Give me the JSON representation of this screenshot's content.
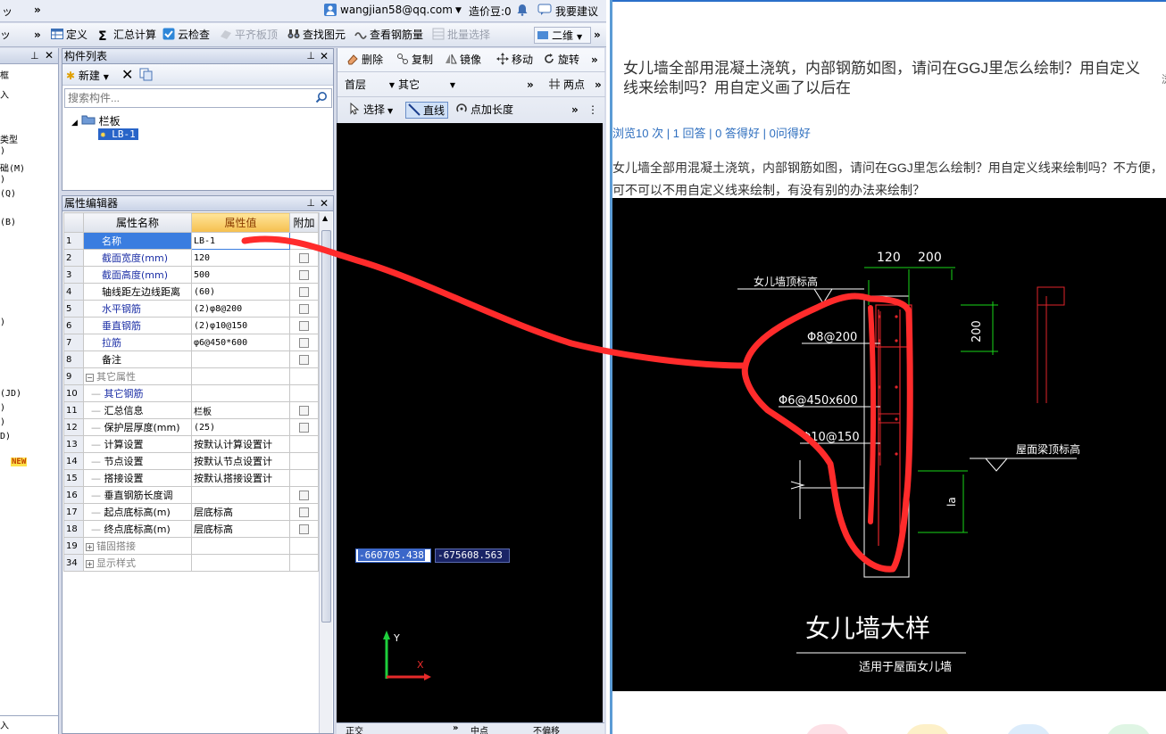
{
  "titlebar": {
    "left_glyph": "ッ",
    "user_email": "wangjian58@qq.com",
    "price_beans": "造价豆:0",
    "feedback": "我要建议"
  },
  "toolbar": {
    "define": "定义",
    "summary": "汇总计算",
    "cloud_check": "云检查",
    "flush_slab": "平齐板顶",
    "find_element": "查找图元",
    "view_rebar": "查看钢筋量",
    "batch_select": "批量选择",
    "view_mode": "二维"
  },
  "leftnav": {
    "rows": [
      "框",
      "入",
      "类型",
      ")",
      "础(M)",
      ")",
      "(Q)",
      "(B)",
      ")",
      "(JD)",
      ")",
      ")",
      "D)",
      "NEW",
      "入"
    ]
  },
  "complist": {
    "title": "构件列表",
    "new_label": "新建",
    "search_placeholder": "搜索构件...",
    "tree_root": "栏板",
    "tree_child": "LB-1"
  },
  "propedit": {
    "title": "属性编辑器",
    "col_name": "属性名称",
    "col_value": "属性值",
    "col_extra": "附加",
    "rows": [
      {
        "num": "1",
        "name": "名称",
        "value": "LB-1"
      },
      {
        "num": "2",
        "name": "截面宽度(mm)",
        "value": "120"
      },
      {
        "num": "3",
        "name": "截面高度(mm)",
        "value": "500"
      },
      {
        "num": "4",
        "name": "轴线距左边线距离",
        "value": "(60)"
      },
      {
        "num": "5",
        "name": "水平钢筋",
        "value": "(2)φ8@200"
      },
      {
        "num": "6",
        "name": "垂直钢筋",
        "value": "(2)φ10@150"
      },
      {
        "num": "7",
        "name": "拉筋",
        "value": "φ6@450*600"
      },
      {
        "num": "8",
        "name": "备注",
        "value": ""
      },
      {
        "num": "9",
        "name": "其它属性",
        "value": ""
      },
      {
        "num": "10",
        "name": "其它钢筋",
        "value": ""
      },
      {
        "num": "11",
        "name": "汇总信息",
        "value": "栏板"
      },
      {
        "num": "12",
        "name": "保护层厚度(mm)",
        "value": "(25)"
      },
      {
        "num": "13",
        "name": "计算设置",
        "value": "按默认计算设置计"
      },
      {
        "num": "14",
        "name": "节点设置",
        "value": "按默认节点设置计"
      },
      {
        "num": "15",
        "name": "搭接设置",
        "value": "按默认搭接设置计"
      },
      {
        "num": "16",
        "name": "垂直钢筋长度调",
        "value": ""
      },
      {
        "num": "17",
        "name": "起点底标高(m)",
        "value": "层底标高"
      },
      {
        "num": "18",
        "name": "终点底标高(m)",
        "value": "层底标高"
      },
      {
        "num": "19",
        "name": "锚固搭接",
        "value": ""
      },
      {
        "num": "34",
        "name": "显示样式",
        "value": ""
      }
    ]
  },
  "drawing": {
    "delete": "删除",
    "copy": "复制",
    "mirror": "镜像",
    "move": "移动",
    "rotate": "旋转",
    "floor": "首层",
    "category": "其它",
    "two_point": "两点",
    "select": "选择",
    "line": "直线",
    "point_length": "点加长度",
    "coord_x": "-660705.438",
    "coord_y": "-675608.563",
    "axis_y": "Y",
    "axis_x": "X",
    "bottom_tabs": [
      "正交",
      "中点",
      "不偏移"
    ]
  },
  "question": {
    "title": "女儿墙全部用混凝土浇筑，内部钢筋如图，请问在GGJ里怎么绘制？用自定义线来绘制吗？用自定义画了以后在",
    "stats_views": "浏览10 次",
    "stats_answers": "1 回答",
    "stats_good": "0 答得好",
    "stats_asks": "0问得好",
    "body": "女儿墙全部用混凝土浇筑，内部钢筋如图，请问在GGJ里怎么绘制？用自定义线来绘制吗？不方便，可不可以不用自定义线来绘制，有没有别的办法来绘制？",
    "edge_char": "浏"
  },
  "cad": {
    "dim_120": "120",
    "dim_200_top": "200",
    "dim_200_side": "200",
    "label_parapet_top": "女儿墙顶标高",
    "label_h_rebar": "Φ8@200",
    "label_tie": "Φ6@450x600",
    "label_v_rebar": "Φ10@150",
    "label_roof_beam": "屋面梁顶标高",
    "label_la": "la",
    "title": "女儿墙大样",
    "subtitle": "适用于屋面女儿墙"
  },
  "colors": {
    "annotation_red": "#ff2b2b",
    "cad_green": "#19d619",
    "cad_red": "#e0242a",
    "link_blue": "#2f6fbf"
  }
}
